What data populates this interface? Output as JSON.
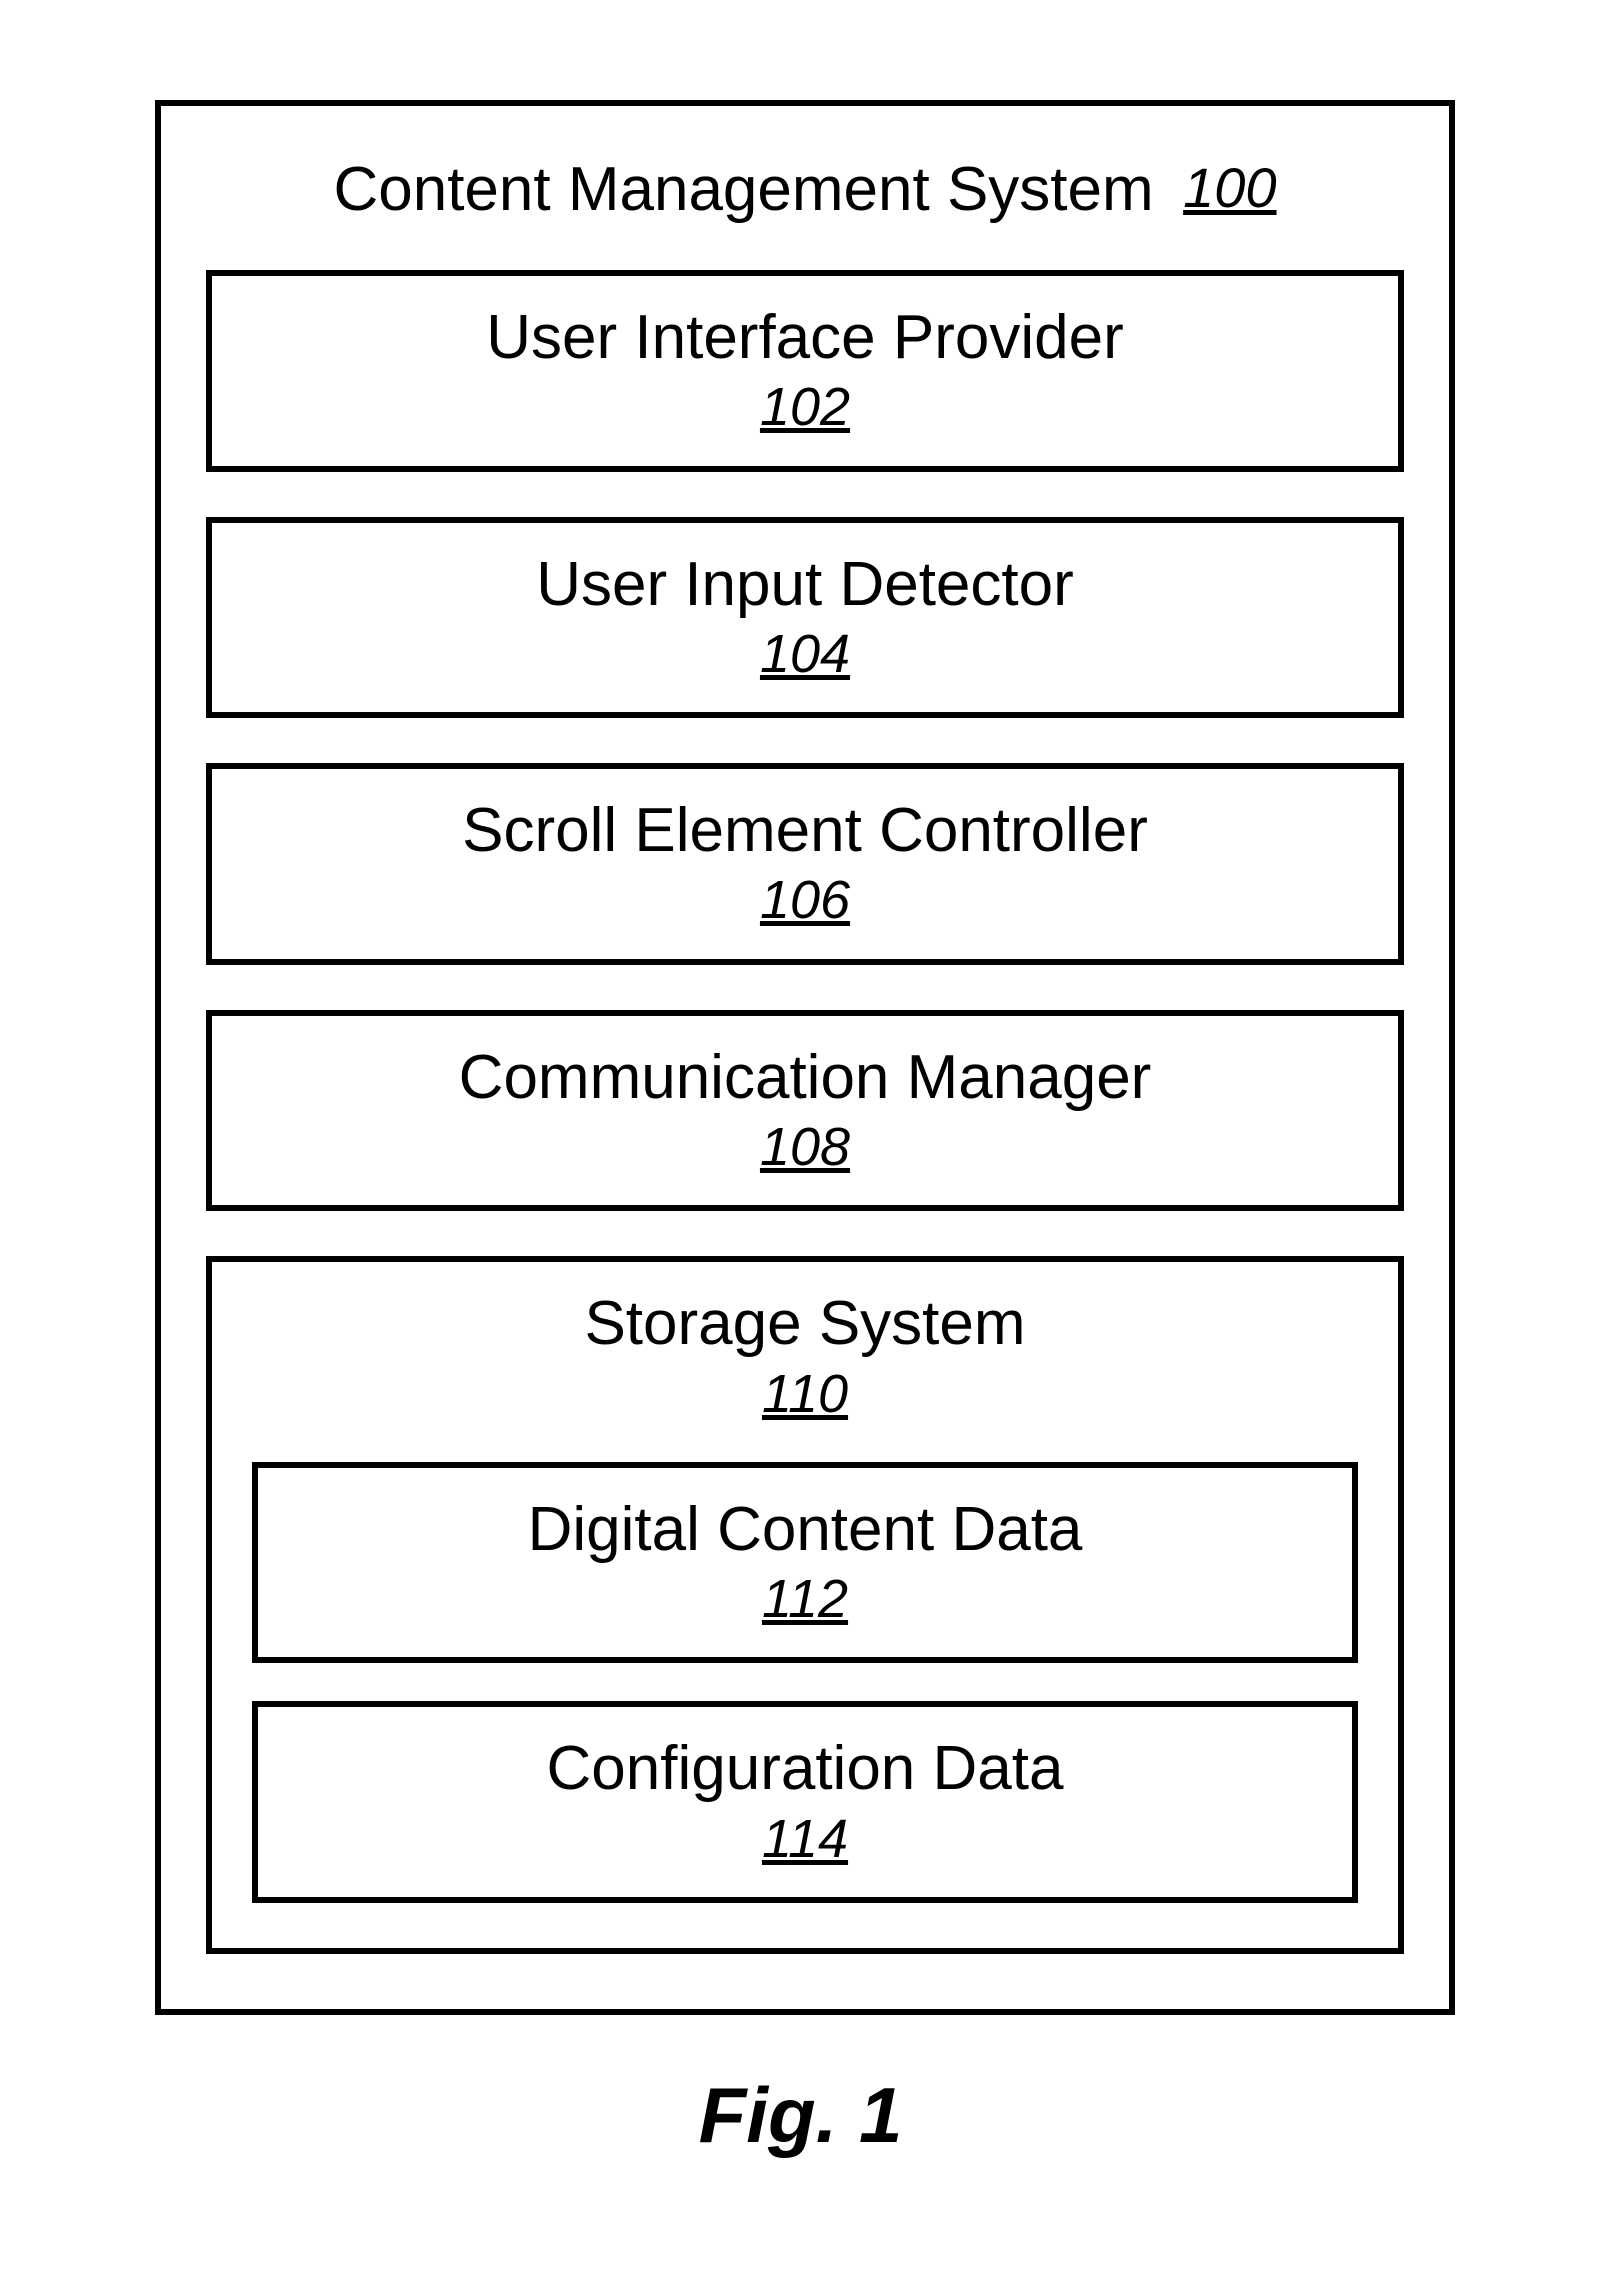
{
  "diagram": {
    "title": "Content Management System",
    "title_ref": "100",
    "components": [
      {
        "label": "User Interface Provider",
        "ref": "102"
      },
      {
        "label": "User Input Detector",
        "ref": "104"
      },
      {
        "label": "Scroll Element Controller",
        "ref": "106"
      },
      {
        "label": "Communication Manager",
        "ref": "108"
      }
    ],
    "storage": {
      "label": "Storage System",
      "ref": "110",
      "children": [
        {
          "label": "Digital Content Data",
          "ref": "112"
        },
        {
          "label": "Configuration Data",
          "ref": "114"
        }
      ]
    }
  },
  "caption": "Fig. 1"
}
